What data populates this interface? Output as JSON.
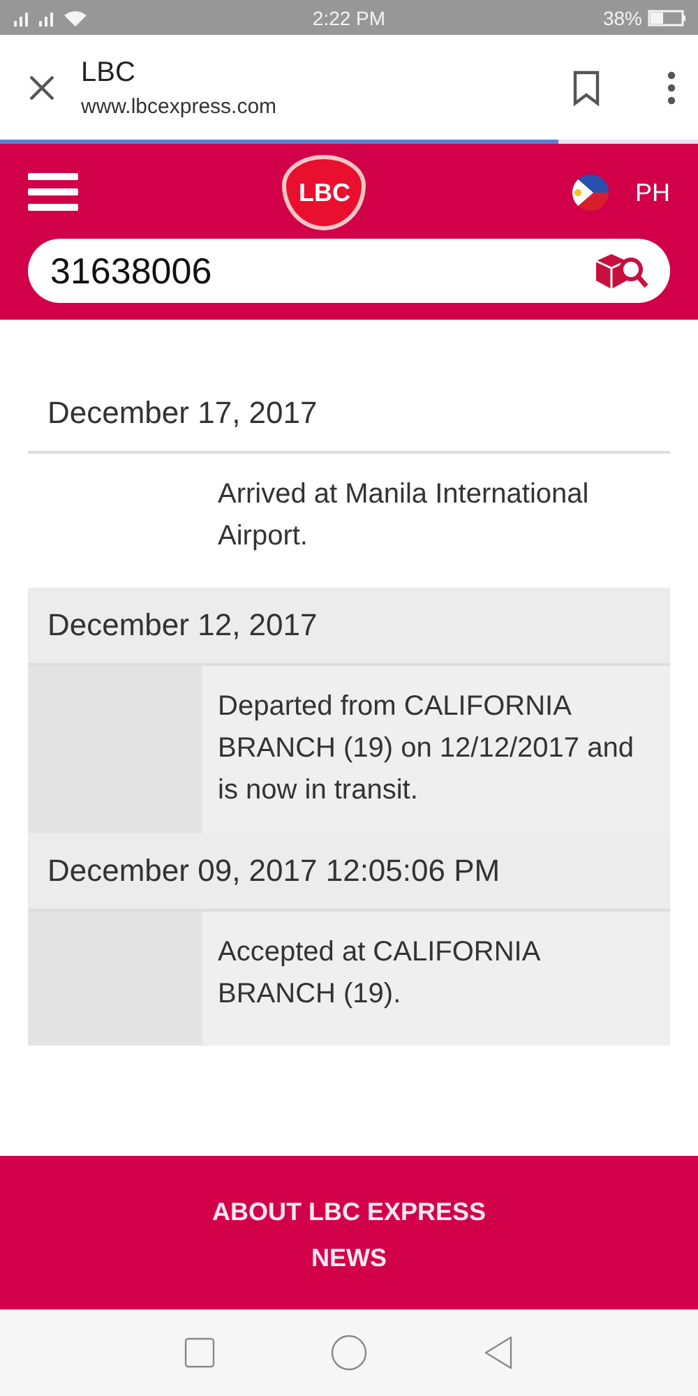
{
  "status_bar": {
    "time": "2:22 PM",
    "battery": "38%"
  },
  "browser": {
    "title": "LBC",
    "url": "www.lbcexpress.com"
  },
  "load_progress": {
    "level": 0.8
  },
  "header": {
    "logo": "LBC",
    "country": "PH"
  },
  "search": {
    "value": "31638006"
  },
  "tracking": [
    {
      "date": "December 17, 2017",
      "event": "Arrived at Manila International Airport.",
      "shaded": false
    },
    {
      "date": "December 12, 2017",
      "event": "Departed from CALIFORNIA BRANCH (19) on 12/12/2017 and is now in transit.",
      "shaded": true
    },
    {
      "date": "December 09, 2017 12:05:06 PM",
      "event": "Accepted at CALIFORNIA BRANCH (19).",
      "shaded": true
    }
  ],
  "footer": {
    "links": [
      "ABOUT LBC EXPRESS",
      "NEWS"
    ]
  }
}
